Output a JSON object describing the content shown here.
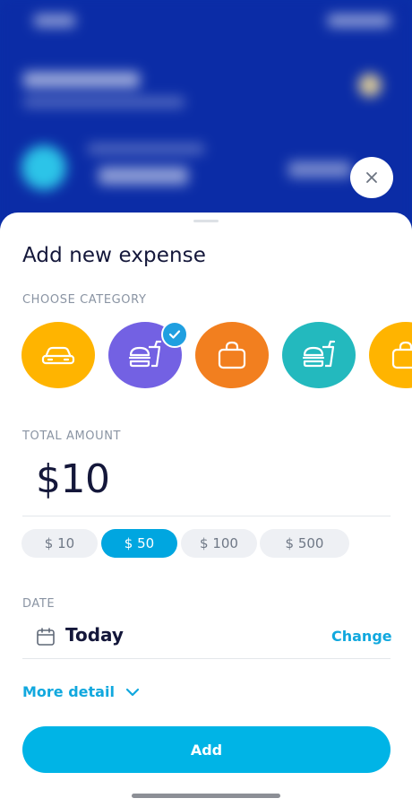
{
  "sheet": {
    "title": "Add new expense",
    "category_label": "CHOOSE CATEGORY",
    "amount_label": "TOTAL AMOUNT",
    "amount_value": "$10",
    "date_label": "DATE",
    "date_value": "Today",
    "change_label": "Change",
    "more_detail_label": "More detail",
    "add_label": "Add"
  },
  "categories": [
    {
      "icon": "car-icon",
      "color": "#ffb400",
      "selected": false
    },
    {
      "icon": "food-icon",
      "color": "#7361e3",
      "selected": true
    },
    {
      "icon": "shopping-bag-icon",
      "color": "#f27f1f",
      "selected": false
    },
    {
      "icon": "food-icon",
      "color": "#23b9be",
      "selected": false
    },
    {
      "icon": "shopping-bag-icon",
      "color": "#ffb400",
      "selected": false
    }
  ],
  "quick_amounts": [
    {
      "label": "$ 10",
      "active": false
    },
    {
      "label": "$ 50",
      "active": true
    },
    {
      "label": "$ 100",
      "active": false
    },
    {
      "label": "$ 500",
      "active": false
    }
  ],
  "colors": {
    "accent": "#00b4e6",
    "link": "#11a8de",
    "background_app": "#0b2ca6",
    "text_primary": "#14173a",
    "text_muted": "#8a94a3"
  }
}
